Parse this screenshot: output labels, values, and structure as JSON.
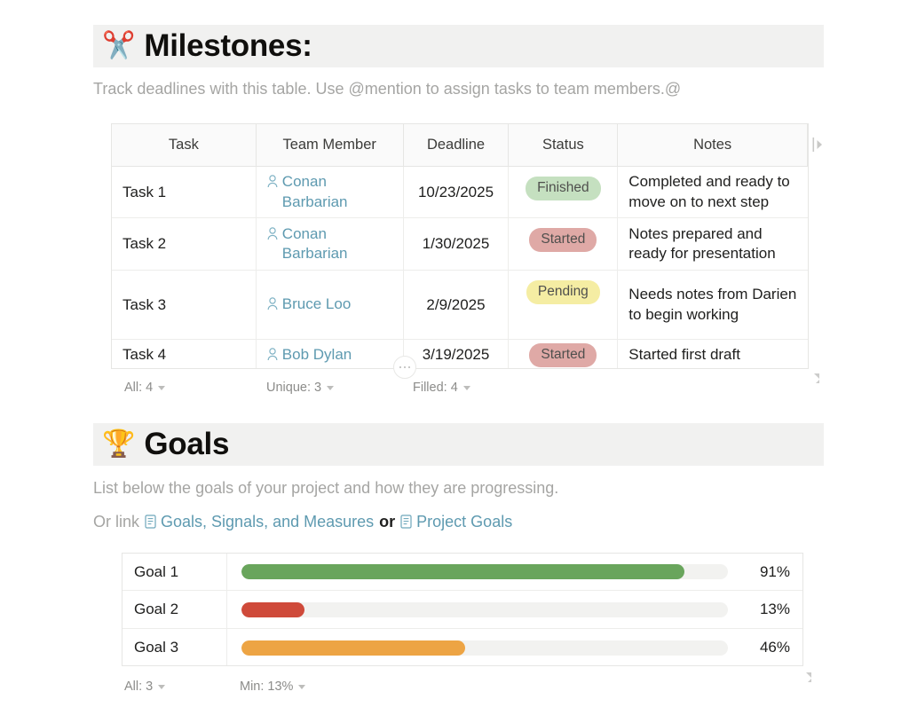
{
  "milestones": {
    "emoji": "✂️",
    "emoji_name": "scissors-emoji",
    "title": "Milestones:",
    "description": "Track deadlines with this table. Use @mention to assign tasks to team members.@",
    "table": {
      "columns": [
        "Task",
        "Team Member",
        "Deadline",
        "Status",
        "Notes"
      ],
      "rows": [
        {
          "task": "Task 1",
          "member": "Conan Barbarian",
          "deadline": "10/23/2025",
          "status": "Finished",
          "status_kind": "finished",
          "notes": "Completed and ready to move on to next step"
        },
        {
          "task": "Task 2",
          "member": "Conan Barbarian",
          "deadline": "1/30/2025",
          "status": "Started",
          "status_kind": "started",
          "notes": "Notes prepared and ready for presentation"
        },
        {
          "task": "Task 3",
          "member": "Bruce Loo",
          "deadline": "2/9/2025",
          "status": "Pending",
          "status_kind": "pending",
          "notes": "Needs notes from Darien to begin working"
        },
        {
          "task": "Task 4",
          "member": "Bob Dylan",
          "deadline": "3/19/2025",
          "status": "Started",
          "status_kind": "started",
          "notes": "Started first draft"
        }
      ]
    },
    "summary": [
      {
        "label": "All: 4"
      },
      {
        "label": "Unique: 3"
      },
      {
        "label": "Filled: 4"
      }
    ]
  },
  "goals": {
    "emoji": "🏆",
    "emoji_name": "trophy-emoji",
    "title": "Goals",
    "description": "List below the goals of your project and how they are progressing.",
    "link_line": {
      "prefix": "Or link",
      "link1": "Goals, Signals, and Measures",
      "conjunction": "or",
      "link2": "Project Goals"
    },
    "table": {
      "rows": [
        {
          "name": "Goal 1",
          "percent_label": "91%",
          "percent": 91,
          "color": "#69a55c"
        },
        {
          "name": "Goal 2",
          "percent_label": "13%",
          "percent": 13,
          "color": "#cf4a3a"
        },
        {
          "name": "Goal 3",
          "percent_label": "46%",
          "percent": 46,
          "color": "#eda444"
        }
      ]
    },
    "summary": [
      {
        "label": "All: 3"
      },
      {
        "label": "Min: 13%"
      }
    ]
  },
  "colors": {
    "banner_bg": "#f1f1f0",
    "link": "#5e9ab0",
    "muted_text": "#a5a5a3",
    "badge_finished": "#c5e0c0",
    "badge_started": "#dfa9a6",
    "badge_pending": "#f5eda3",
    "track": "#f2f2f0"
  }
}
